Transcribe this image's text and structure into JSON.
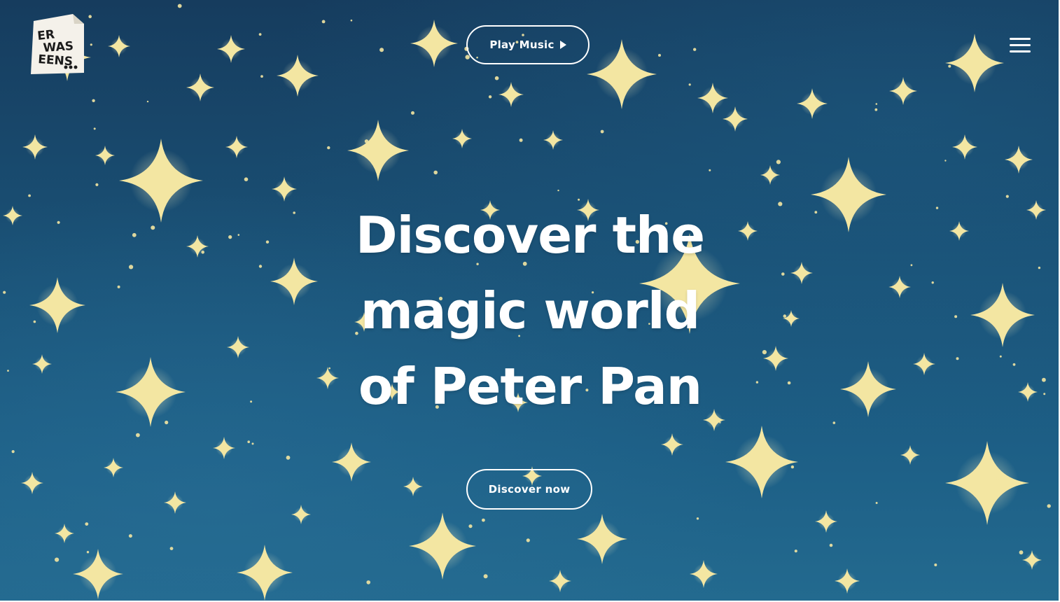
{
  "header": {
    "logo_lines": [
      "ER",
      "WAS",
      "EENS..."
    ],
    "play_label": "Play Music",
    "menu_icon": "hamburger-menu-icon"
  },
  "hero": {
    "title_lines": [
      "Discover the",
      "magic world",
      "of Peter Pan"
    ],
    "cta_label": "Discover now"
  },
  "colors": {
    "sky_dark": "#163c5e",
    "sky_light": "#236a8f",
    "star": "#f3e6a2",
    "text": "#ffffff"
  }
}
